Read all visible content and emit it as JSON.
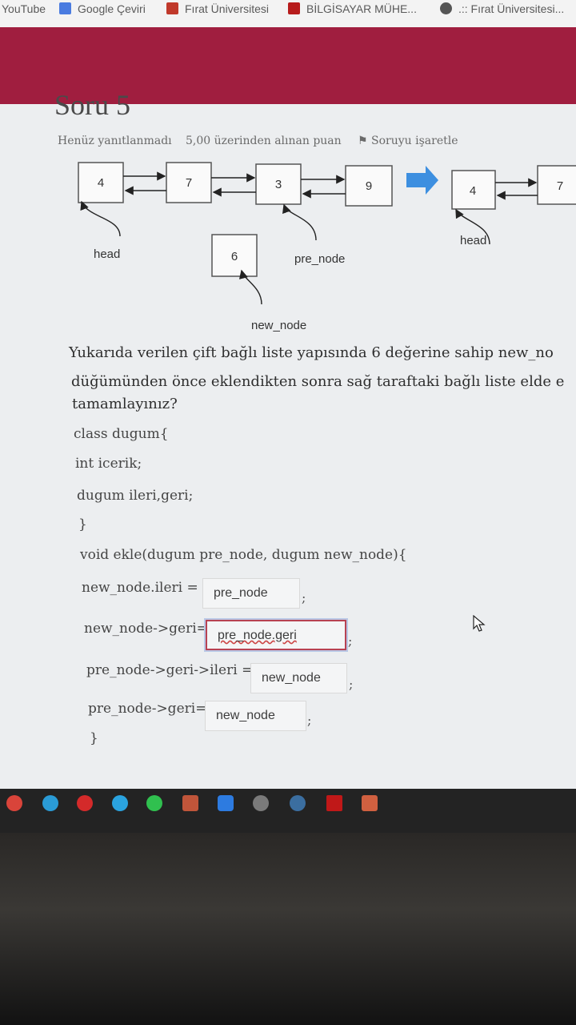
{
  "bookmarks": [
    {
      "label": "YouTube",
      "icon": "youtube-icon",
      "color": "#e33"
    },
    {
      "label": "Google Çeviri",
      "icon": "translate-icon",
      "color": "#4a7be0"
    },
    {
      "label": "Fırat Üniversitesi",
      "icon": "university-icon",
      "color": "#c0392b"
    },
    {
      "label": "BİLGİSAYAR MÜHE...",
      "icon": "university-icon",
      "color": "#b71c1c"
    },
    {
      "label": ".:: Fırat Üniversitesi...",
      "icon": "globe-icon",
      "color": "#555"
    }
  ],
  "colors": {
    "banner": "#a01e3f",
    "arrow": "#3d8fe0"
  },
  "question": {
    "title": "Soru 5",
    "status": "Henüz yanıtlanmadı",
    "points": "5,00 üzerinden alınan puan",
    "flag": "Soruyu işaretle",
    "text_line1": "Yukarıda verilen çift bağlı liste yapısında 6  değerine sahip new_no",
    "text_line2": "düğümünden önce eklendikten sonra sağ taraftaki bağlı liste elde e",
    "text_line3": "tamamlayınız?"
  },
  "diagram": {
    "left_nodes": [
      "4",
      "7",
      "3",
      "9"
    ],
    "new_node_value": "6",
    "label_head": "head",
    "label_pre_node": "pre_node",
    "label_new_node": "new_node",
    "right_nodes": [
      "4",
      "7"
    ],
    "right_label_head": "head"
  },
  "code": {
    "line1": "class dugum{",
    "line2": "int icerik;",
    "line3": "dugum ileri,geri;",
    "line4": "}",
    "line5": "void ekle(dugum pre_node, dugum new_node){",
    "line10": "}"
  },
  "answers": [
    {
      "label": "new_node.ileri =",
      "value": "pre_node"
    },
    {
      "label": "new_node->geri=",
      "value": "pre_node.geri"
    },
    {
      "label": "pre_node->geri->ileri =",
      "value": "new_node"
    },
    {
      "label": "pre_node->geri=",
      "value": "new_node"
    }
  ],
  "semicolon": ";",
  "taskbar": [
    {
      "icon": "chrome-icon",
      "color": "#d9443a"
    },
    {
      "icon": "edge-icon",
      "color": "#2a9bd6"
    },
    {
      "icon": "opera-icon",
      "color": "#d42a2a"
    },
    {
      "icon": "telegram-icon",
      "color": "#2aa3df"
    },
    {
      "icon": "whatsapp-icon",
      "color": "#30c04f"
    },
    {
      "icon": "app-icon",
      "color": "#c0553a"
    },
    {
      "icon": "zoom-icon",
      "color": "#2d7be0"
    },
    {
      "icon": "vpn-icon",
      "color": "#7a7a7a"
    },
    {
      "icon": "steam-icon",
      "color": "#3b6ea0"
    },
    {
      "icon": "netflix-icon",
      "color": "#c01818"
    },
    {
      "icon": "game-icon",
      "color": "#d06040"
    }
  ]
}
